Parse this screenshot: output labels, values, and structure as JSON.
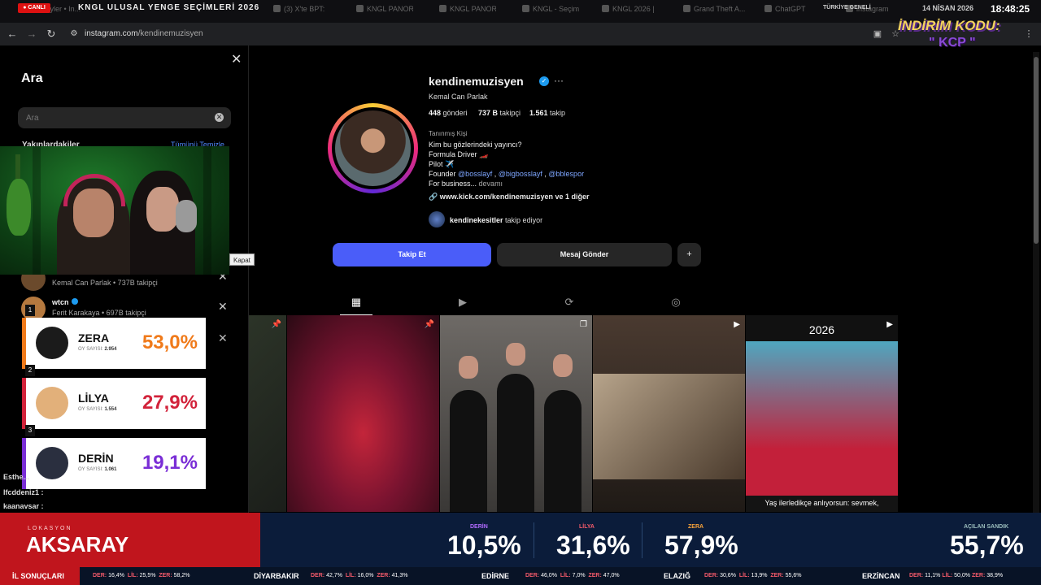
{
  "broadcast": {
    "live_badge": "● CANLI",
    "event_title": "KNGL ULUSAL YENGE SEÇİMLERİ 2026",
    "region": "TÜRKİYE GENELİ",
    "date": "14 NİSAN 2026",
    "time": "18:48:25",
    "promo_title": "İNDİRİM KODU:",
    "promo_code": "\" KCP \""
  },
  "browser": {
    "tabs": [
      "...eyler • In...",
      "(3) X'te BPT:",
      "KNGL PANOR",
      "KNGL PANOR",
      "KNGL - Seçim",
      "KNGL 2026 |",
      "Grand Theft A...",
      "ChatGPT",
      "instagram"
    ],
    "url_host": "instagram.com",
    "url_path": "/kendinemuzisyen"
  },
  "search": {
    "title": "Ara",
    "placeholder": "Ara",
    "recent_heading": "Yakınlardakiler",
    "clear_all": "Tümünü Temizle",
    "tooltip_close": "Kapat",
    "recent": [
      {
        "name": "kendinemuzisyen",
        "sub": "Kemal Can Parlak • 737B takipçi"
      },
      {
        "name": "wtcn",
        "sub": "Ferit Karakaya • 697B takipçi"
      }
    ]
  },
  "profile": {
    "username": "kendinemuzisyen",
    "full_name": "Kemal Can Parlak",
    "posts_count": "448",
    "posts_label": "gönderi",
    "followers_count": "737 B",
    "followers_label": "takipçi",
    "following_count": "1.561",
    "following_label": "takip",
    "category": "Tanınmış Kişi",
    "bio_line1": "Kim bu gözlerindeki yayıncı?",
    "bio_line2": "Formula Driver 🏎️",
    "bio_line3": "Pilot ✈️",
    "bio_founder": "Founder",
    "bio_tag1": "@bosslayf",
    "bio_tag2": "@bigbosslayf",
    "bio_tag3": "@bblespor",
    "bio_line5": "For business...",
    "bio_more": "devamı",
    "website": "www.kick.com/kendinemuzisyen ve 1 diğer",
    "followed_by_user": "kendinekesitler",
    "followed_by_text": "takip ediyor",
    "follow_button": "Takip Et",
    "message_button": "Mesaj Gönder",
    "post5_year": "2026",
    "post5_caption": "Yaş ilerledikçe anlıyorsun: sevmek,"
  },
  "votes": [
    {
      "rank": "1",
      "name": "ZERA",
      "votes_label": "OY SAYISI:",
      "votes": "2.954",
      "pct": "53,0%",
      "color": "#f07a1a"
    },
    {
      "rank": "2",
      "name": "LİLYA",
      "votes_label": "OY SAYISI:",
      "votes": "1.554",
      "pct": "27,9%",
      "color": "#d2223a"
    },
    {
      "rank": "3",
      "name": "DERİN",
      "votes_label": "OY SAYISI:",
      "votes": "1.061",
      "pct": "19,1%",
      "color": "#7a2ed6"
    }
  ],
  "chat": [
    "Esthe...",
    "lfcddeniz1 :",
    "kaanavsar :"
  ],
  "results": {
    "location_label": "LOKASYON",
    "location": "AKSARAY",
    "derin_label": "DERİN",
    "derin": "10,5%",
    "lilya_label": "LİLYA",
    "lilya": "31,6%",
    "zera_label": "ZERA",
    "zera": "57,9%",
    "turnout_label": "AÇILAN SANDIK",
    "turnout": "55,7%"
  },
  "ticker": {
    "label": "İL SONUÇLARI",
    "items": [
      {
        "city": "",
        "der": "16,4%",
        "lil": "25,5%",
        "zer": "58,2%"
      },
      {
        "city": "DİYARBAKIR",
        "der": "42,7%",
        "lil": "16,0%",
        "zer": "41,3%"
      },
      {
        "city": "EDİRNE",
        "der": "46,0%",
        "lil": "7,0%",
        "zer": "47,0%"
      },
      {
        "city": "ELAZIĞ",
        "der": "30,6%",
        "lil": "13,9%",
        "zer": "55,6%"
      },
      {
        "city": "ERZİNCAN",
        "der": "11,1%",
        "lil": "50,0%",
        "zer": "38,9%"
      }
    ],
    "der_key": "DER:",
    "lil_key": "LİL:",
    "zer_key": "ZER:"
  },
  "colors": {
    "instagram_blue": "#4a5df9",
    "ticker_red": "#c0151d",
    "ticker_navy": "#0b1c3a"
  }
}
